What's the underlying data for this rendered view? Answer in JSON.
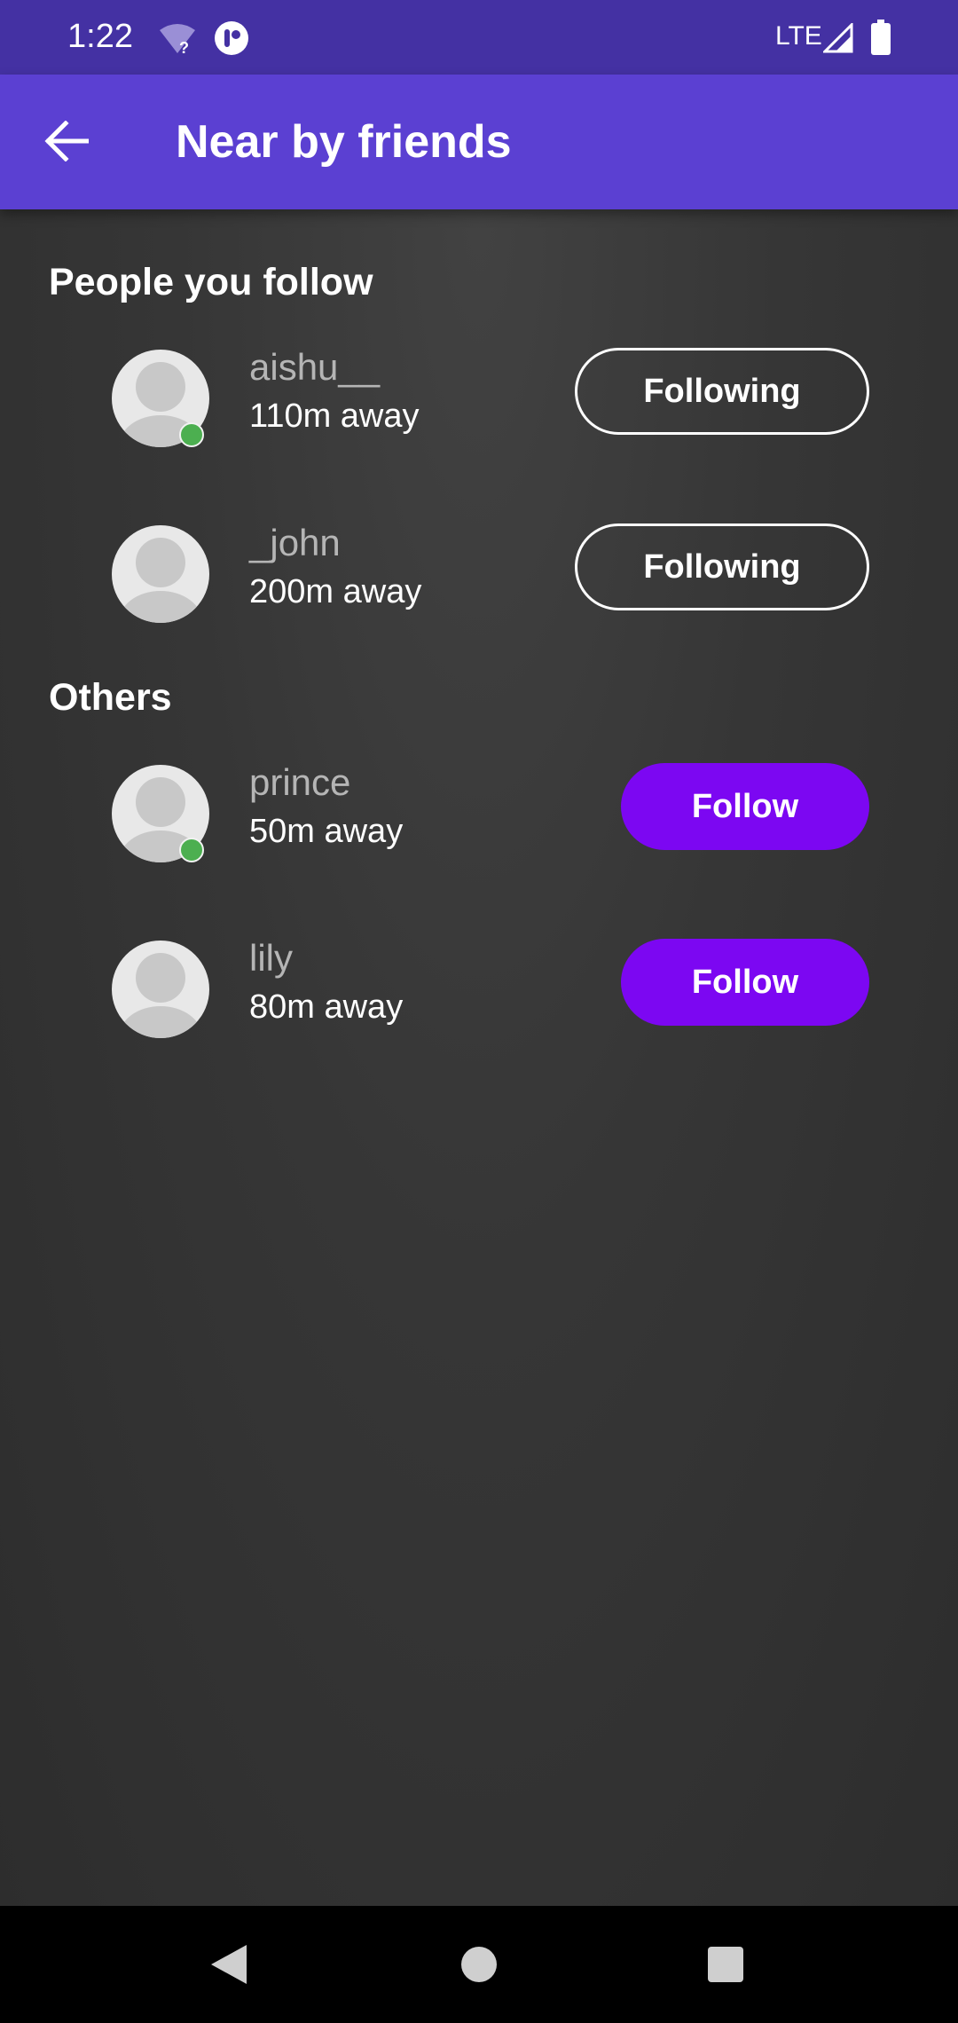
{
  "status_bar": {
    "time": "1:22",
    "network": "LTE"
  },
  "app_bar": {
    "title": "Near by friends"
  },
  "sections": [
    {
      "title": "People you follow",
      "people": [
        {
          "name": "aishu__",
          "distance": "110m away",
          "online": true,
          "button": "Following"
        },
        {
          "name": "_john",
          "distance": "200m away",
          "online": false,
          "button": "Following"
        }
      ]
    },
    {
      "title": "Others",
      "people": [
        {
          "name": "prince",
          "distance": "50m away",
          "online": true,
          "button": "Follow"
        },
        {
          "name": "lily",
          "distance": "80m away",
          "online": false,
          "button": "Follow"
        }
      ]
    }
  ],
  "colors": {
    "status_bar": "#4431a3",
    "app_bar": "#5b40d2",
    "follow_button": "#7c07f2",
    "online": "#4caf50"
  }
}
